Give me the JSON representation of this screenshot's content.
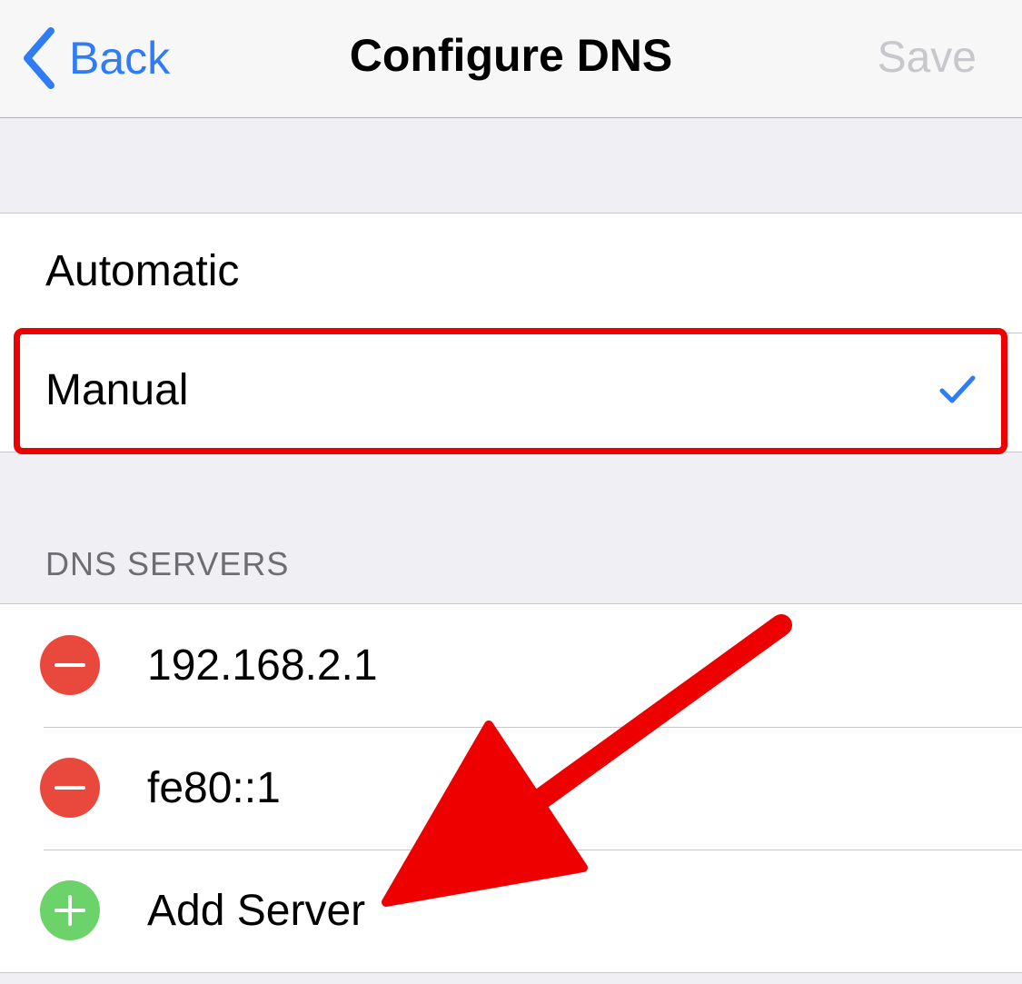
{
  "navbar": {
    "back_label": "Back",
    "title": "Configure DNS",
    "save_label": "Save"
  },
  "dns_mode": {
    "options": [
      {
        "label": "Automatic",
        "selected": false
      },
      {
        "label": "Manual",
        "selected": true
      }
    ]
  },
  "dns_servers": {
    "header": "DNS SERVERS",
    "servers": [
      "192.168.2.1",
      "fe80::1"
    ],
    "add_label": "Add Server"
  },
  "colors": {
    "accent": "#2f7cf6",
    "remove": "#e9493c",
    "add": "#6cd36a",
    "annotation": "#ee0000",
    "disabled": "#c7c7cc"
  },
  "icons": {
    "back": "chevron-left-icon",
    "selected": "checkmark-icon",
    "remove": "minus-circle-icon",
    "add": "plus-circle-icon",
    "annotation": "arrow-icon"
  }
}
